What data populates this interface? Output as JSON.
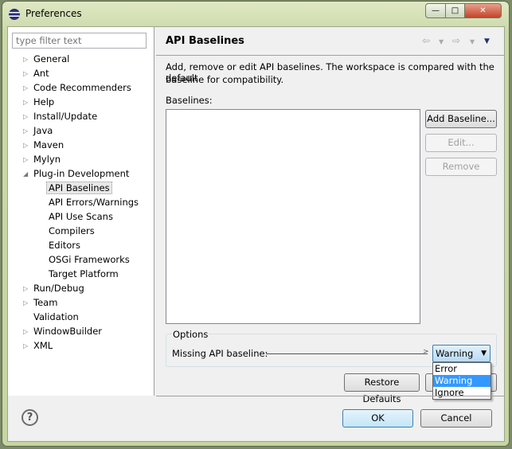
{
  "window": {
    "title": "Preferences",
    "minimize": "—",
    "maximize": "□",
    "close": "✕"
  },
  "filter": {
    "placeholder": "type filter text"
  },
  "tree": [
    {
      "label": "General",
      "expandable": true
    },
    {
      "label": "Ant",
      "expandable": true
    },
    {
      "label": "Code Recommenders",
      "expandable": true
    },
    {
      "label": "Help",
      "expandable": true
    },
    {
      "label": "Install/Update",
      "expandable": true
    },
    {
      "label": "Java",
      "expandable": true
    },
    {
      "label": "Maven",
      "expandable": true
    },
    {
      "label": "Mylyn",
      "expandable": true
    },
    {
      "label": "Plug-in Development",
      "expandable": true,
      "expanded": true
    },
    {
      "label": "API Baselines",
      "child": true,
      "selected": true
    },
    {
      "label": "API Errors/Warnings",
      "child": true
    },
    {
      "label": "API Use Scans",
      "child": true
    },
    {
      "label": "Compilers",
      "child": true
    },
    {
      "label": "Editors",
      "child": true
    },
    {
      "label": "OSGi Frameworks",
      "child": true
    },
    {
      "label": "Target Platform",
      "child": true
    },
    {
      "label": "Run/Debug",
      "expandable": true
    },
    {
      "label": "Team",
      "expandable": true
    },
    {
      "label": "Validation",
      "expandable": false
    },
    {
      "label": "WindowBuilder",
      "expandable": true
    },
    {
      "label": "XML",
      "expandable": true
    }
  ],
  "page": {
    "title": "API Baselines",
    "description_line1": "Add, remove or edit API baselines. The workspace is compared with the default",
    "description_line2": "baseline for compatibility.",
    "baselines_label": "Baselines:",
    "add_baseline": "Add Baseline...",
    "edit": "Edit...",
    "remove": "Remove",
    "options_label": "Options",
    "missing_label": "Missing API baseline:",
    "combo_value": "Warning",
    "combo_options": [
      "Error",
      "Warning",
      "Ignore"
    ],
    "restore_defaults": "Restore Defaults"
  },
  "footer": {
    "help": "?",
    "ok": "OK",
    "cancel": "Cancel"
  }
}
